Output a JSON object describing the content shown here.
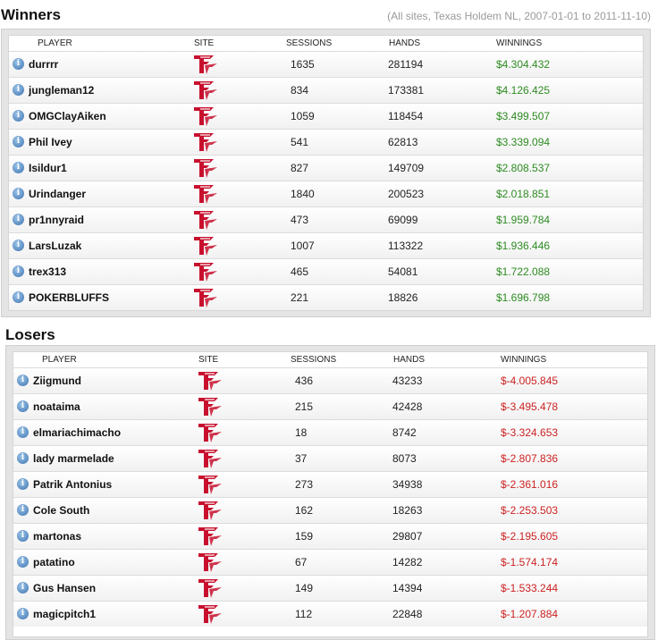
{
  "winners": {
    "title": "Winners",
    "filter": "(All sites, Texas Holdem NL, 2007-01-01 to 2011-11-10)",
    "columns": {
      "player": "PLAYER",
      "site": "SITE",
      "sessions": "SESSIONS",
      "hands": "HANDS",
      "winnings": "WINNINGS"
    },
    "rows": [
      {
        "player": "durrrr",
        "site": "Full Tilt",
        "sessions": "1635",
        "hands": "281194",
        "winnings": "$4.304.432"
      },
      {
        "player": "jungleman12",
        "site": "Full Tilt",
        "sessions": "834",
        "hands": "173381",
        "winnings": "$4.126.425"
      },
      {
        "player": "OMGClayAiken",
        "site": "Full Tilt",
        "sessions": "1059",
        "hands": "118454",
        "winnings": "$3.499.507"
      },
      {
        "player": "Phil Ivey",
        "site": "Full Tilt",
        "sessions": "541",
        "hands": "62813",
        "winnings": "$3.339.094"
      },
      {
        "player": "Isildur1",
        "site": "Full Tilt",
        "sessions": "827",
        "hands": "149709",
        "winnings": "$2.808.537"
      },
      {
        "player": "Urindanger",
        "site": "Full Tilt",
        "sessions": "1840",
        "hands": "200523",
        "winnings": "$2.018.851"
      },
      {
        "player": "pr1nnyraid",
        "site": "Full Tilt",
        "sessions": "473",
        "hands": "69099",
        "winnings": "$1.959.784"
      },
      {
        "player": "LarsLuzak",
        "site": "Full Tilt",
        "sessions": "1007",
        "hands": "113322",
        "winnings": "$1.936.446"
      },
      {
        "player": "trex313",
        "site": "Full Tilt",
        "sessions": "465",
        "hands": "54081",
        "winnings": "$1.722.088"
      },
      {
        "player": "POKERBLUFFS",
        "site": "Full Tilt",
        "sessions": "221",
        "hands": "18826",
        "winnings": "$1.696.798"
      }
    ]
  },
  "losers": {
    "title": "Losers",
    "columns": {
      "player": "PLAYER",
      "site": "SITE",
      "sessions": "SESSIONS",
      "hands": "HANDS",
      "winnings": "WINNINGS"
    },
    "rows": [
      {
        "player": "Ziigmund",
        "site": "Full Tilt",
        "sessions": "436",
        "hands": "43233",
        "winnings": "$-4.005.845"
      },
      {
        "player": "noataima",
        "site": "Full Tilt",
        "sessions": "215",
        "hands": "42428",
        "winnings": "$-3.495.478"
      },
      {
        "player": "elmariachimacho",
        "site": "Full Tilt",
        "sessions": "18",
        "hands": "8742",
        "winnings": "$-3.324.653"
      },
      {
        "player": "lady marmelade",
        "site": "Full Tilt",
        "sessions": "37",
        "hands": "8073",
        "winnings": "$-2.807.836"
      },
      {
        "player": "Patrik Antonius",
        "site": "Full Tilt",
        "sessions": "273",
        "hands": "34938",
        "winnings": "$-2.361.016"
      },
      {
        "player": "Cole South",
        "site": "Full Tilt",
        "sessions": "162",
        "hands": "18263",
        "winnings": "$-2.253.503"
      },
      {
        "player": "martonas",
        "site": "Full Tilt",
        "sessions": "159",
        "hands": "29807",
        "winnings": "$-2.195.605"
      },
      {
        "player": "patatino",
        "site": "Full Tilt",
        "sessions": "67",
        "hands": "14282",
        "winnings": "$-1.574.174"
      },
      {
        "player": "Gus Hansen",
        "site": "Full Tilt",
        "sessions": "149",
        "hands": "14394",
        "winnings": "$-1.533.244"
      },
      {
        "player": "magicpitch1",
        "site": "Full Tilt",
        "sessions": "112",
        "hands": "22848",
        "winnings": "$-1.207.884"
      }
    ]
  },
  "info_icon_glyph": "i",
  "colors": {
    "positive": "#2e8b22",
    "negative": "#cc2222",
    "site_logo": "#c8102e"
  }
}
